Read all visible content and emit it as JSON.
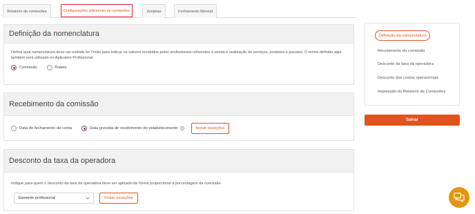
{
  "tabs": [
    {
      "label": "Relatório de comissões"
    },
    {
      "label": "Configurações adicionais de comissões"
    },
    {
      "label": "Gorjetas"
    },
    {
      "label": "Fechamento Mensal"
    }
  ],
  "nomenclatura": {
    "title": "Definição da nomenclatura",
    "description": "Defina qual nomenclatura deve ser exibida no Trinks para indicar os valores recebidos pelos profissionais referentes à venda e realização de serviços, produtos e pacotes. O termo definido aqui também será utilizado no Aplicativo Profissional.",
    "options": [
      {
        "label": "Comissão",
        "selected": true
      },
      {
        "label": "Rateio",
        "selected": false
      }
    ]
  },
  "recebimento": {
    "title": "Recebimento da comissão",
    "options": [
      {
        "label": "Data do fechamento de conta",
        "selected": false
      },
      {
        "label": "Data prevista de recebimento do estabelecimento",
        "selected": true
      }
    ],
    "button": "Incluir exceções"
  },
  "desconto": {
    "title": "Desconto da taxa da operadora",
    "description": "Indique para quem o desconto da taxa da operadora deve ser aplicado de forma proporcional à porcentagem da comissão.",
    "select_value": "Somente profissional",
    "button": "Incluir exceções"
  },
  "sidebar": {
    "items": [
      {
        "label": "Definição da nomenclatura",
        "active": true
      },
      {
        "label": "Recebimento da comissão"
      },
      {
        "label": "Desconto da taxa da operadora"
      },
      {
        "label": "Desconto dos custos operacionais"
      },
      {
        "label": "Impressão do Relatório de Comissões"
      }
    ],
    "save_label": "Salvar"
  },
  "colors": {
    "accent": "#e0531d",
    "highlight_border": "#d8202f",
    "radio_selected": "#8a4a7a",
    "chat_button": "#e8930f"
  },
  "icons": {
    "info": "info-icon",
    "dropdown": "chevron-down-icon",
    "chat": "chat-icon"
  }
}
